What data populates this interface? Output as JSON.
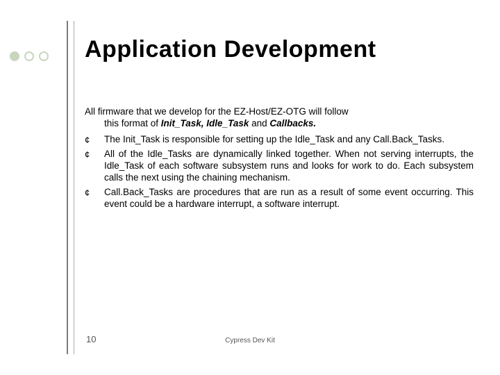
{
  "title": "Application Development",
  "intro_line1": "All firmware that we develop for the EZ-Host/EZ-OTG will follow",
  "intro_line2_prefix": "this format of ",
  "intro_emph": "Init_Task, Idle_Task",
  "intro_line2_middle": " and ",
  "intro_emph2": "Callbacks.",
  "bullet_glyph": "¢",
  "items": [
    "The Init_Task is responsible for setting up the Idle_Task and any Call.Back_Tasks.",
    "All of the Idle_Tasks are dynamically linked together. When not serving interrupts, the Idle_Task of each software subsystem runs and looks for work to do. Each subsystem calls the next using the chaining mechanism.",
    "Call.Back_Tasks are procedures that are run as a result of some event occurring. This event could be a hardware interrupt, a software interrupt."
  ],
  "page_number": "10",
  "footer": "Cypress Dev Kit"
}
